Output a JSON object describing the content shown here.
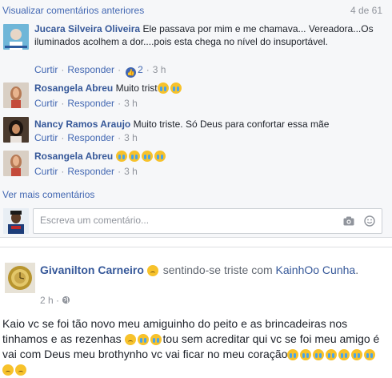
{
  "comments_section": {
    "view_previous": "Visualizar comentários anteriores",
    "count": "4 de 61",
    "comments": [
      {
        "author": "Jucara Silveira Oliveira",
        "text": "Ele passava por mim e me chamava... Vereadora...Os iluminados acolhem a dor....pois esta chega no nível do insuportável.",
        "like": "Curtir",
        "reply": "Responder",
        "reactions": "2",
        "time": "3 h"
      },
      {
        "author": "Rosangela Abreu",
        "text": "Muito trist",
        "like": "Curtir",
        "reply": "Responder",
        "time": "3 h"
      },
      {
        "author": "Nancy Ramos Araujo",
        "text": "Muito triste. Só Deus para confortar essa mãe",
        "like": "Curtir",
        "reply": "Responder",
        "time": "3 h"
      },
      {
        "author": "Rosangela Abreu",
        "text": "",
        "like": "Curtir",
        "reply": "Responder",
        "time": "3 h"
      }
    ],
    "more_comments": "Ver mais comentários",
    "composer_placeholder": "Escreva um comentário..."
  },
  "post": {
    "author": "Givanilton Carneiro",
    "feeling": "sentindo-se triste com",
    "tagged": "KainhOo Cunha",
    "time": "2 h",
    "text_part1": "Kaio vc se foi tão novo meu amiguinho do peito e as brincadeiras nos tinhamos e as rezenhas",
    "text_part2": "tou sem acreditar qui vc se foi meu amigo é vai com Deus meu brothynho vc vai ficar no meu coração"
  },
  "colors": {
    "link": "#4267b2",
    "author": "#365899",
    "meta": "#90949c",
    "background": "#f6f7f9"
  },
  "icons": [
    "like-icon",
    "camera-icon",
    "smiley-icon",
    "globe-icon",
    "sad-emoji",
    "crying-emoji"
  ]
}
